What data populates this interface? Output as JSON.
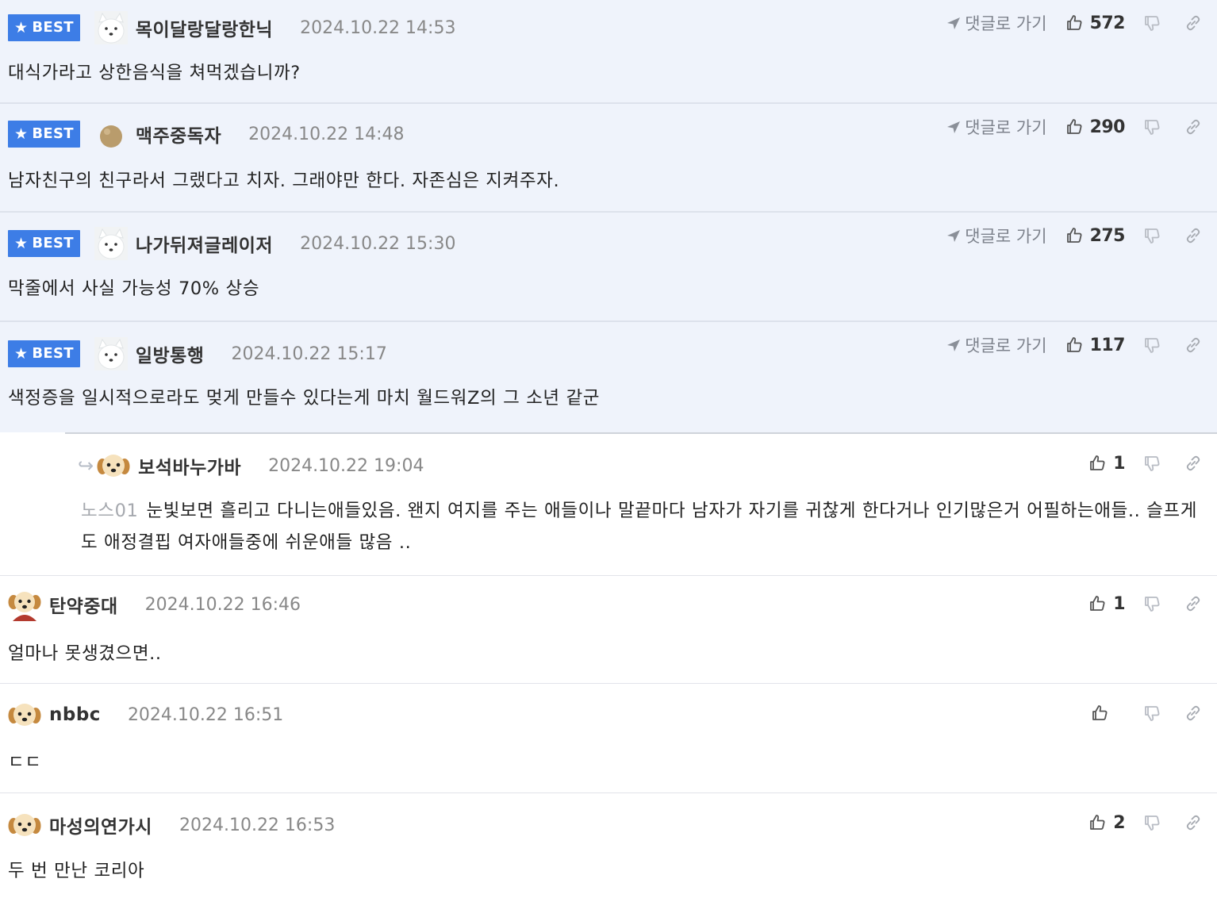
{
  "badge_label": "BEST",
  "goto_label": "댓글로 가기",
  "comments": [
    {
      "nick": "목이달랑달랑한닉",
      "date": "2024.10.22 14:53",
      "body": "대식가라고 상한음식을 쳐먹겠습니까?",
      "likes": "572",
      "avatar": "white-dog"
    },
    {
      "nick": "맥주중독자",
      "date": "2024.10.22 14:48",
      "body": "남자친구의 친구라서 그랬다고 치자. 그래야만 한다. 자존심은 지켜주자.",
      "likes": "290",
      "avatar": "bead"
    },
    {
      "nick": "나가뒤져글레이저",
      "date": "2024.10.22 15:30",
      "body": "막줄에서 사실 가능성 70% 상승",
      "likes": "275",
      "avatar": "white-dog"
    },
    {
      "nick": "일방통행",
      "date": "2024.10.22 15:17",
      "body": "색정증을 일시적으로라도 멎게 만들수 있다는게 마치 월드워Z의 그 소년 같군",
      "likes": "117",
      "avatar": "white-dog"
    }
  ],
  "reply": {
    "nick": "보석바누가바",
    "date": "2024.10.22 19:04",
    "mention": "노스01",
    "body": "눈빛보면 흘리고 다니는애들있음. 왠지 여지를 주는 애들이나 말끝마다 남자가 자기를 귀찮게 한다거나 인기많은거 어필하는애들.. 슬프게도 애정결핍 여자애들중에 쉬운애들 많음 ..",
    "likes": "1",
    "avatar": "puppy"
  },
  "normal_comments": [
    {
      "nick": "탄약중대",
      "date": "2024.10.22 16:46",
      "body": "얼마나 못생겼으면..",
      "likes": "1",
      "avatar": "puppy-red"
    },
    {
      "nick": "nbbc",
      "date": "2024.10.22 16:51",
      "body": "ㄷㄷ",
      "likes": "",
      "avatar": "puppy"
    },
    {
      "nick": "마성의연가시",
      "date": "2024.10.22 16:53",
      "body": "두 번 만난 코리아",
      "likes": "2",
      "avatar": "puppy"
    }
  ],
  "icons": {
    "like": "thumbs-up-icon",
    "dislike": "thumbs-down-icon",
    "link": "link-icon",
    "goto": "arrow-icon"
  },
  "colors": {
    "best_badge": "#3d7de6",
    "best_bg": "#eff3fb"
  }
}
